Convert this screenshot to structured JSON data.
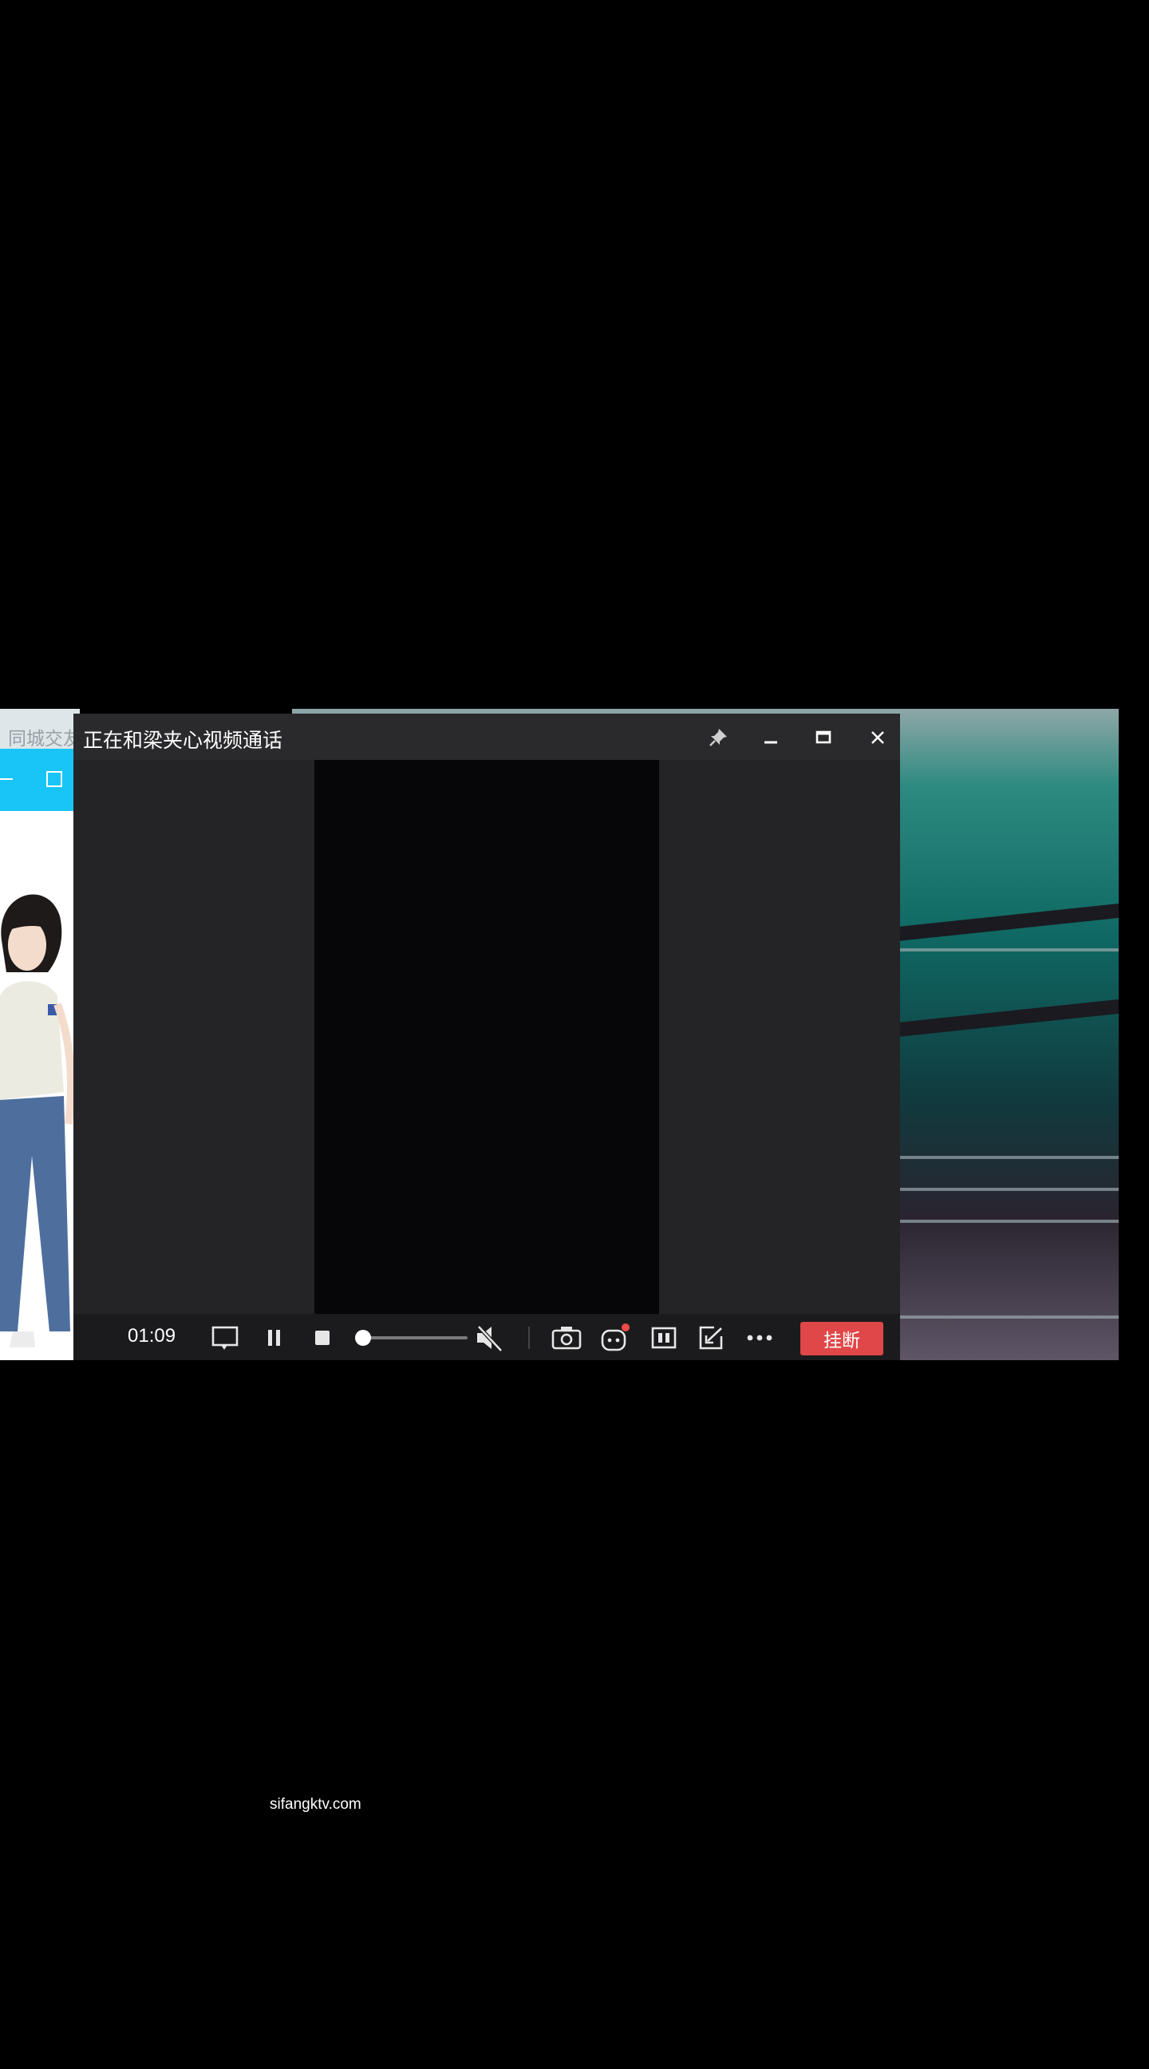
{
  "background_app": {
    "title": "同城交友",
    "header_color": "#19c5f7"
  },
  "call_window": {
    "title": "正在和梁夹心视频通话",
    "timer": "01:09",
    "hangup_label": "挂断",
    "volume_level": 0.04,
    "muted": true,
    "icons": {
      "pin": "pin-icon",
      "minimize": "minimize-icon",
      "maximize": "maximize-icon",
      "close": "close-icon",
      "chat": "chat-bubble-icon",
      "pause": "pause-icon",
      "stop": "stop-icon",
      "mute": "speaker-muted-icon",
      "screenshot": "camera-icon",
      "effects": "avatar-effects-icon",
      "layout": "split-screen-icon",
      "share": "share-screen-icon",
      "more": "more-icon"
    },
    "colors": {
      "hangup": "#e04748",
      "titlebar": "#2a2a2c",
      "controls": "#1b1b1d"
    }
  },
  "watermark": "sifangktv.com"
}
